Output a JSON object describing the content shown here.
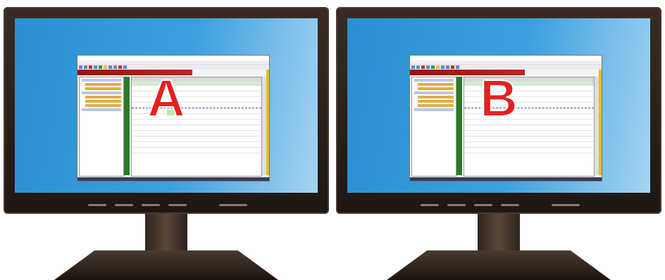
{
  "monitors": [
    {
      "id": "left",
      "letter": "A"
    },
    {
      "id": "right",
      "letter": "B"
    }
  ],
  "colors": {
    "letter": "#e62020",
    "screen_gradient_start": "#2a8fd0",
    "screen_gradient_end": "#a7d4f2",
    "bezel": "#2a1f18"
  }
}
